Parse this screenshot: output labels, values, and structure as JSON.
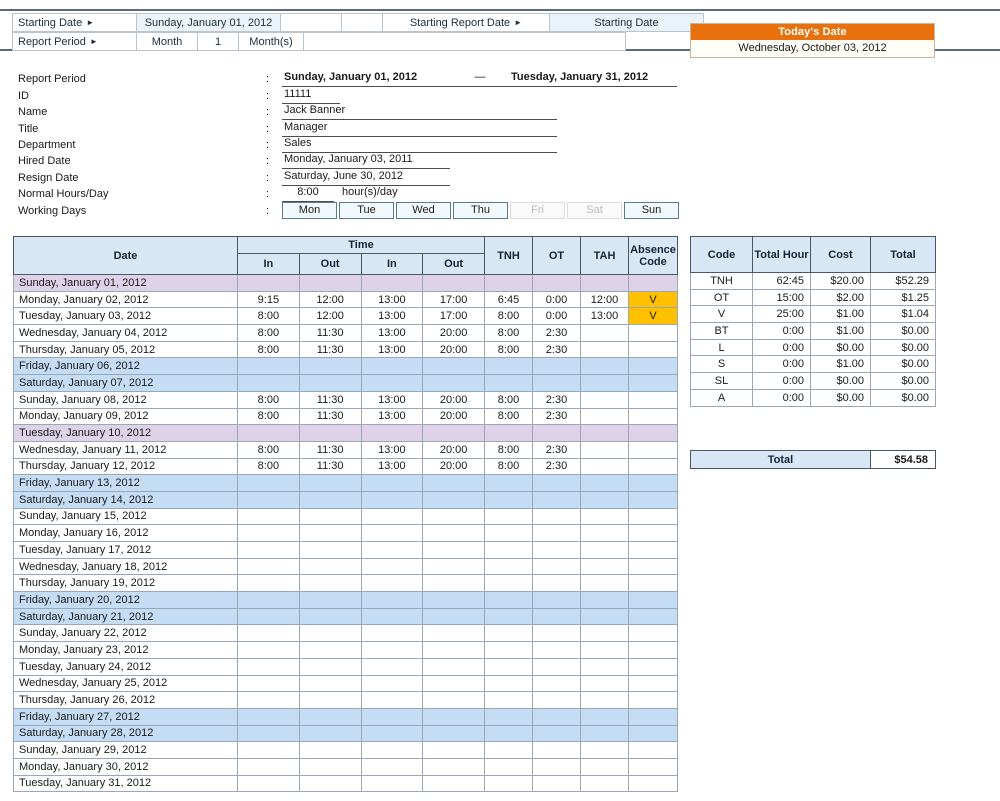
{
  "topbar": {
    "starting_date_label": "Starting Date",
    "starting_date_value": "Sunday, January 01, 2012",
    "starting_report_date_label": "Starting Report Date",
    "starting_report_date_value": "Starting Date",
    "report_period_label": "Report Period",
    "report_period_unit": "Month",
    "report_period_count": "1",
    "report_period_suffix": "Month(s)",
    "todays_date_label": "Today's Date",
    "todays_date_value": "Wednesday, October 03, 2012",
    "accent_orange": "#e8700d"
  },
  "info": {
    "report_period_label": "Report Period",
    "report_period_start": "Sunday, January 01, 2012",
    "report_period_dash": "—",
    "report_period_end": "Tuesday, January 31, 2012",
    "id_label": "ID",
    "id_value": "11111",
    "name_label": "Name",
    "name_value": "Jack Banner",
    "title_label": "Title",
    "title_value": "Manager",
    "department_label": "Department",
    "department_value": "Sales",
    "hired_date_label": "Hired Date",
    "hired_date_value": "Monday, January 03, 2011",
    "resign_date_label": "Resign Date",
    "resign_date_value": "Saturday, June 30, 2012",
    "normal_hours_label": "Normal Hours/Day",
    "normal_hours_value": "8:00",
    "normal_hours_unit": "hour(s)/day",
    "working_days_label": "Working Days",
    "colon": ":",
    "working_days": [
      {
        "day": "Mon",
        "enabled": true
      },
      {
        "day": "Tue",
        "enabled": true
      },
      {
        "day": "Wed",
        "enabled": true
      },
      {
        "day": "Thu",
        "enabled": true
      },
      {
        "day": "Fri",
        "enabled": false
      },
      {
        "day": "Sat",
        "enabled": false
      },
      {
        "day": "Sun",
        "enabled": true
      }
    ]
  },
  "timesheet": {
    "headers": {
      "date": "Date",
      "time": "Time",
      "in1": "In",
      "out1": "Out",
      "in2": "In",
      "out2": "Out",
      "tnh": "TNH",
      "ot": "OT",
      "tah": "TAH",
      "absence_code": "Absence Code"
    },
    "rows": [
      {
        "date": "Sunday, January 01, 2012",
        "in1": "",
        "out1": "",
        "in2": "",
        "out2": "",
        "tnh": "",
        "ot": "",
        "tah": "",
        "abs": "",
        "style": "holiday"
      },
      {
        "date": "Monday, January 02, 2012",
        "in1": "9:15",
        "out1": "12:00",
        "in2": "13:00",
        "out2": "17:00",
        "tnh": "6:45",
        "ot": "0:00",
        "tah": "12:00",
        "abs": "V",
        "style": "normal"
      },
      {
        "date": "Tuesday, January 03, 2012",
        "in1": "8:00",
        "out1": "12:00",
        "in2": "13:00",
        "out2": "17:00",
        "tnh": "8:00",
        "ot": "0:00",
        "tah": "13:00",
        "abs": "V",
        "style": "normal"
      },
      {
        "date": "Wednesday, January 04, 2012",
        "in1": "8:00",
        "out1": "11:30",
        "in2": "13:00",
        "out2": "20:00",
        "tnh": "8:00",
        "ot": "2:30",
        "tah": "",
        "abs": "",
        "style": "normal"
      },
      {
        "date": "Thursday, January 05, 2012",
        "in1": "8:00",
        "out1": "11:30",
        "in2": "13:00",
        "out2": "20:00",
        "tnh": "8:00",
        "ot": "2:30",
        "tah": "",
        "abs": "",
        "style": "normal"
      },
      {
        "date": "Friday, January 06, 2012",
        "in1": "",
        "out1": "",
        "in2": "",
        "out2": "",
        "tnh": "",
        "ot": "",
        "tah": "",
        "abs": "",
        "style": "weekend"
      },
      {
        "date": "Saturday, January 07, 2012",
        "in1": "",
        "out1": "",
        "in2": "",
        "out2": "",
        "tnh": "",
        "ot": "",
        "tah": "",
        "abs": "",
        "style": "weekend"
      },
      {
        "date": "Sunday, January 08, 2012",
        "in1": "8:00",
        "out1": "11:30",
        "in2": "13:00",
        "out2": "20:00",
        "tnh": "8:00",
        "ot": "2:30",
        "tah": "",
        "abs": "",
        "style": "normal"
      },
      {
        "date": "Monday, January 09, 2012",
        "in1": "8:00",
        "out1": "11:30",
        "in2": "13:00",
        "out2": "20:00",
        "tnh": "8:00",
        "ot": "2:30",
        "tah": "",
        "abs": "",
        "style": "normal"
      },
      {
        "date": "Tuesday, January 10, 2012",
        "in1": "",
        "out1": "",
        "in2": "",
        "out2": "",
        "tnh": "",
        "ot": "",
        "tah": "",
        "abs": "",
        "style": "holiday"
      },
      {
        "date": "Wednesday, January 11, 2012",
        "in1": "8:00",
        "out1": "11:30",
        "in2": "13:00",
        "out2": "20:00",
        "tnh": "8:00",
        "ot": "2:30",
        "tah": "",
        "abs": "",
        "style": "normal"
      },
      {
        "date": "Thursday, January 12, 2012",
        "in1": "8:00",
        "out1": "11:30",
        "in2": "13:00",
        "out2": "20:00",
        "tnh": "8:00",
        "ot": "2:30",
        "tah": "",
        "abs": "",
        "style": "normal"
      },
      {
        "date": "Friday, January 13, 2012",
        "in1": "",
        "out1": "",
        "in2": "",
        "out2": "",
        "tnh": "",
        "ot": "",
        "tah": "",
        "abs": "",
        "style": "weekend"
      },
      {
        "date": "Saturday, January 14, 2012",
        "in1": "",
        "out1": "",
        "in2": "",
        "out2": "",
        "tnh": "",
        "ot": "",
        "tah": "",
        "abs": "",
        "style": "weekend"
      },
      {
        "date": "Sunday, January 15, 2012",
        "in1": "",
        "out1": "",
        "in2": "",
        "out2": "",
        "tnh": "",
        "ot": "",
        "tah": "",
        "abs": "",
        "style": "normal"
      },
      {
        "date": "Monday, January 16, 2012",
        "in1": "",
        "out1": "",
        "in2": "",
        "out2": "",
        "tnh": "",
        "ot": "",
        "tah": "",
        "abs": "",
        "style": "normal"
      },
      {
        "date": "Tuesday, January 17, 2012",
        "in1": "",
        "out1": "",
        "in2": "",
        "out2": "",
        "tnh": "",
        "ot": "",
        "tah": "",
        "abs": "",
        "style": "normal"
      },
      {
        "date": "Wednesday, January 18, 2012",
        "in1": "",
        "out1": "",
        "in2": "",
        "out2": "",
        "tnh": "",
        "ot": "",
        "tah": "",
        "abs": "",
        "style": "normal"
      },
      {
        "date": "Thursday, January 19, 2012",
        "in1": "",
        "out1": "",
        "in2": "",
        "out2": "",
        "tnh": "",
        "ot": "",
        "tah": "",
        "abs": "",
        "style": "normal"
      },
      {
        "date": "Friday, January 20, 2012",
        "in1": "",
        "out1": "",
        "in2": "",
        "out2": "",
        "tnh": "",
        "ot": "",
        "tah": "",
        "abs": "",
        "style": "weekend"
      },
      {
        "date": "Saturday, January 21, 2012",
        "in1": "",
        "out1": "",
        "in2": "",
        "out2": "",
        "tnh": "",
        "ot": "",
        "tah": "",
        "abs": "",
        "style": "weekend"
      },
      {
        "date": "Sunday, January 22, 2012",
        "in1": "",
        "out1": "",
        "in2": "",
        "out2": "",
        "tnh": "",
        "ot": "",
        "tah": "",
        "abs": "",
        "style": "normal"
      },
      {
        "date": "Monday, January 23, 2012",
        "in1": "",
        "out1": "",
        "in2": "",
        "out2": "",
        "tnh": "",
        "ot": "",
        "tah": "",
        "abs": "",
        "style": "normal"
      },
      {
        "date": "Tuesday, January 24, 2012",
        "in1": "",
        "out1": "",
        "in2": "",
        "out2": "",
        "tnh": "",
        "ot": "",
        "tah": "",
        "abs": "",
        "style": "normal"
      },
      {
        "date": "Wednesday, January 25, 2012",
        "in1": "",
        "out1": "",
        "in2": "",
        "out2": "",
        "tnh": "",
        "ot": "",
        "tah": "",
        "abs": "",
        "style": "normal"
      },
      {
        "date": "Thursday, January 26, 2012",
        "in1": "",
        "out1": "",
        "in2": "",
        "out2": "",
        "tnh": "",
        "ot": "",
        "tah": "",
        "abs": "",
        "style": "normal"
      },
      {
        "date": "Friday, January 27, 2012",
        "in1": "",
        "out1": "",
        "in2": "",
        "out2": "",
        "tnh": "",
        "ot": "",
        "tah": "",
        "abs": "",
        "style": "weekend"
      },
      {
        "date": "Saturday, January 28, 2012",
        "in1": "",
        "out1": "",
        "in2": "",
        "out2": "",
        "tnh": "",
        "ot": "",
        "tah": "",
        "abs": "",
        "style": "weekend"
      },
      {
        "date": "Sunday, January 29, 2012",
        "in1": "",
        "out1": "",
        "in2": "",
        "out2": "",
        "tnh": "",
        "ot": "",
        "tah": "",
        "abs": "",
        "style": "normal"
      },
      {
        "date": "Monday, January 30, 2012",
        "in1": "",
        "out1": "",
        "in2": "",
        "out2": "",
        "tnh": "",
        "ot": "",
        "tah": "",
        "abs": "",
        "style": "normal"
      },
      {
        "date": "Tuesday, January 31, 2012",
        "in1": "",
        "out1": "",
        "in2": "",
        "out2": "",
        "tnh": "",
        "ot": "",
        "tah": "",
        "abs": "",
        "style": "normal"
      }
    ]
  },
  "summary": {
    "headers": {
      "code": "Code",
      "total_hour": "Total Hour",
      "cost": "Cost",
      "total": "Total"
    },
    "rows": [
      {
        "code": "TNH",
        "total_hour": "62:45",
        "cost": "$20.00",
        "total": "$52.29"
      },
      {
        "code": "OT",
        "total_hour": "15:00",
        "cost": "$2.00",
        "total": "$1.25"
      },
      {
        "code": "V",
        "total_hour": "25:00",
        "cost": "$1.00",
        "total": "$1.04"
      },
      {
        "code": "BT",
        "total_hour": "0:00",
        "cost": "$1.00",
        "total": "$0.00"
      },
      {
        "code": "L",
        "total_hour": "0:00",
        "cost": "$0.00",
        "total": "$0.00"
      },
      {
        "code": "S",
        "total_hour": "0:00",
        "cost": "$1.00",
        "total": "$0.00"
      },
      {
        "code": "SL",
        "total_hour": "0:00",
        "cost": "$0.00",
        "total": "$0.00"
      },
      {
        "code": "A",
        "total_hour": "0:00",
        "cost": "$0.00",
        "total": "$0.00"
      }
    ],
    "grand_label": "Total",
    "grand_value": "$54.58"
  }
}
